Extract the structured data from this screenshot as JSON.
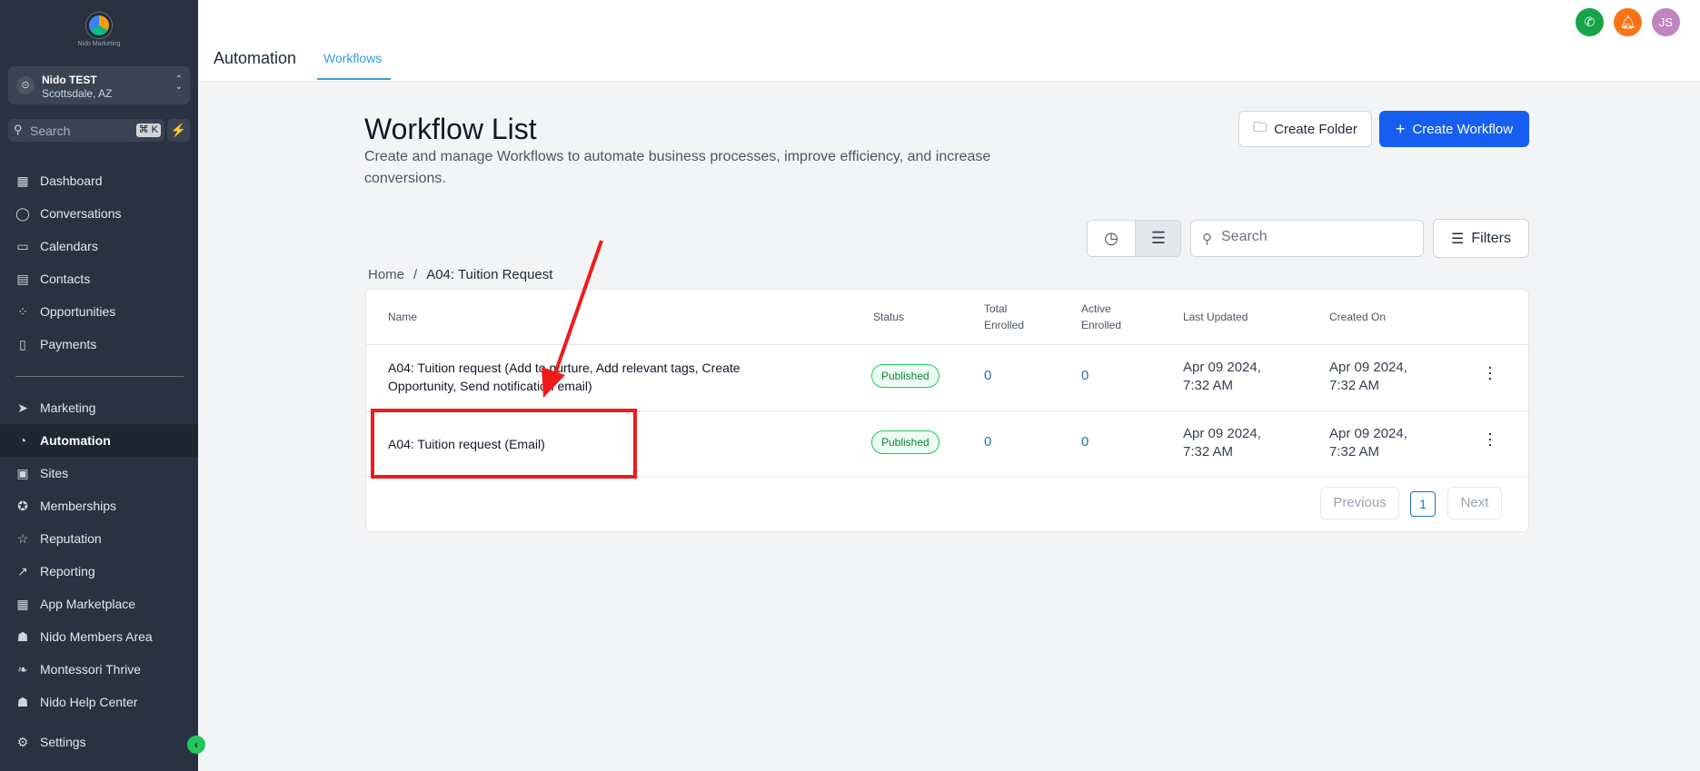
{
  "sidebar": {
    "logo_text": "Nido Marketing",
    "account": {
      "name": "Nido TEST",
      "location": "Scottsdale, AZ"
    },
    "search": {
      "placeholder": "Search",
      "shortcut": "⌘ K"
    },
    "items": [
      {
        "label": "Dashboard",
        "icon": "dashboard-icon"
      },
      {
        "label": "Conversations",
        "icon": "chat-icon"
      },
      {
        "label": "Calendars",
        "icon": "calendar-icon"
      },
      {
        "label": "Contacts",
        "icon": "contacts-icon"
      },
      {
        "label": "Opportunities",
        "icon": "opportunities-icon"
      },
      {
        "label": "Payments",
        "icon": "payments-icon"
      },
      {
        "label": "Marketing",
        "icon": "send-icon"
      },
      {
        "label": "Automation",
        "icon": "automation-icon",
        "active": true
      },
      {
        "label": "Sites",
        "icon": "sites-icon"
      },
      {
        "label": "Memberships",
        "icon": "award-icon"
      },
      {
        "label": "Reputation",
        "icon": "star-icon"
      },
      {
        "label": "Reporting",
        "icon": "chart-line-icon"
      },
      {
        "label": "App Marketplace",
        "icon": "grid-icon"
      },
      {
        "label": "Nido Members Area",
        "icon": "users-icon"
      },
      {
        "label": "Montessori Thrive",
        "icon": "leaf-icon"
      },
      {
        "label": "Nido Help Center",
        "icon": "help-users-icon"
      },
      {
        "label": "Settings",
        "icon": "gear-icon"
      }
    ]
  },
  "header": {
    "title": "Automation",
    "tab": "Workflows",
    "avatar_initials": "JS",
    "colors": {
      "phone": "#16a34a",
      "bell": "#f97316",
      "avatar": "#c084c0"
    }
  },
  "main": {
    "title": "Workflow List",
    "description": "Create and manage Workflows to automate business processes, improve efficiency, and increase conversions.",
    "create_folder_label": "Create Folder",
    "create_workflow_label": "Create Workflow",
    "search_placeholder": "Search",
    "filters_label": "Filters",
    "breadcrumb": {
      "home": "Home",
      "separator": "/",
      "current": "A04: Tuition Request"
    },
    "table": {
      "columns": {
        "name": "Name",
        "status": "Status",
        "total_line1": "Total",
        "total_line2": "Enrolled",
        "active_line1": "Active",
        "active_line2": "Enrolled",
        "last_updated": "Last Updated",
        "created_on": "Created On"
      },
      "rows": [
        {
          "name": "A04: Tuition request (Add to nurture, Add relevant tags, Create Opportunity, Send notification email)",
          "status": "Published",
          "total_enrolled": "0",
          "active_enrolled": "0",
          "last_updated_date": "Apr 09 2024,",
          "last_updated_time": "7:32 AM",
          "created_date": "Apr 09 2024,",
          "created_time": "7:32 AM"
        },
        {
          "name": "A04: Tuition request (Email)",
          "status": "Published",
          "total_enrolled": "0",
          "active_enrolled": "0",
          "last_updated_date": "Apr 09 2024,",
          "last_updated_time": "7:32 AM",
          "created_date": "Apr 09 2024,",
          "created_time": "7:32 AM"
        }
      ]
    },
    "pagination": {
      "previous": "Previous",
      "current": "1",
      "next": "Next"
    }
  },
  "colors": {
    "primary": "#155eef",
    "sidebar_bg": "#2a3241",
    "annotation": "#ef1b1b"
  }
}
